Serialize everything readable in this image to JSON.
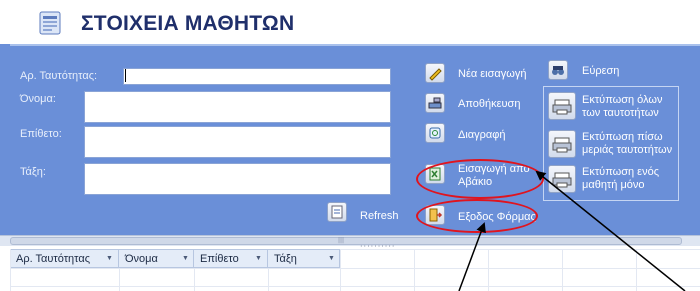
{
  "form": {
    "title": "ΣΤΟΙΧΕΙΑ ΜΑΘΗΤΩΝ",
    "fields": [
      {
        "label": "Αρ. Ταυτότητας:",
        "value": ""
      },
      {
        "label": "Όνομα:",
        "value": ""
      },
      {
        "label": "Επίθετο:",
        "value": ""
      },
      {
        "label": "Τάξη:",
        "value": ""
      }
    ],
    "buttons": {
      "refresh": "Refresh",
      "new_entry": "Νέα εισαγωγή",
      "save": "Αποθήκευση",
      "delete": "Διαγραφή",
      "import_line1": "Εισαγωγή απο",
      "import_line2": "Αβάκιο",
      "exit": "Εξοδος Φόρμας",
      "find": "Εύρεση",
      "print_all_line1": "Εκτύπωση όλων",
      "print_all_line2": "των ταυτοτήτων",
      "print_back_line1": "Εκτύπωση πίσω",
      "print_back_line2": "μεριάς ταυτοτήτων",
      "print_one_line1": "Εκτύπωση ενός",
      "print_one_line2": "μαθητή μόνο"
    },
    "highlight_color": "#e0141e",
    "form_background": "#6a8fd8"
  },
  "datasheet": {
    "columns": [
      "Αρ. Ταυτότητας",
      "Όνομα",
      "Επίθετο",
      "Τάξη"
    ]
  }
}
